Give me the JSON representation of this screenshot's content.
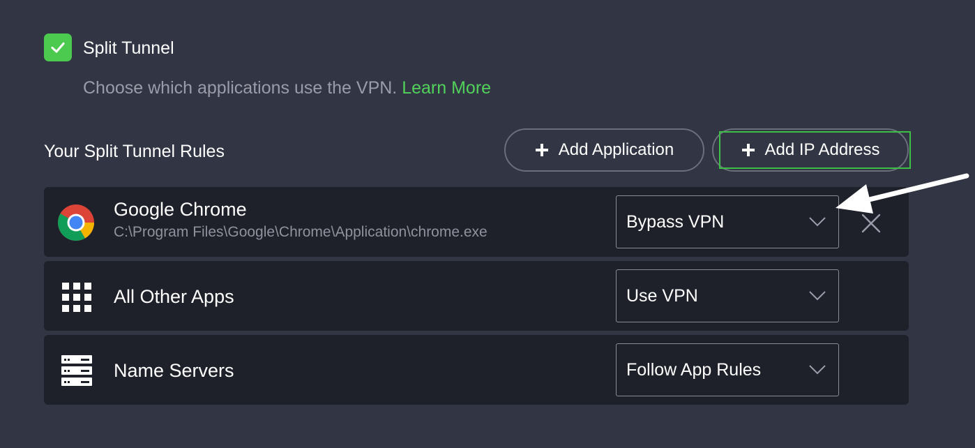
{
  "split_tunnel": {
    "enabled": true,
    "label": "Split Tunnel",
    "description": "Choose which applications use the VPN.",
    "learn_more": "Learn More"
  },
  "rules": {
    "heading": "Your Split Tunnel Rules",
    "add_application_label": "Add Application",
    "add_ip_label": "Add IP Address",
    "items": [
      {
        "name": "Google Chrome",
        "path": "C:\\Program Files\\Google\\Chrome\\Application\\chrome.exe",
        "icon": "chrome-icon",
        "mode": "Bypass VPN"
      },
      {
        "name": "All Other Apps",
        "icon": "apps-grid-icon",
        "mode": "Use VPN"
      },
      {
        "name": "Name Servers",
        "icon": "server-icon",
        "mode": "Follow App Rules"
      }
    ]
  },
  "colors": {
    "background": "#323543",
    "row_background": "#1f212a",
    "accent_green": "#4cc94f",
    "link_green": "#52d15b",
    "muted_text": "#9a9caa"
  }
}
